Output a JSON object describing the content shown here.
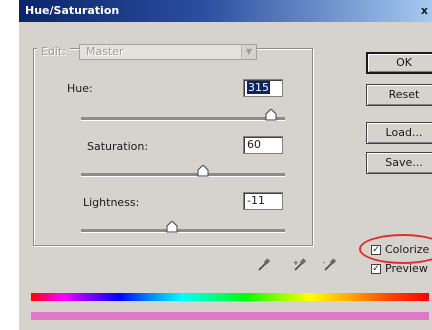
{
  "window": {
    "title": "Hue/Saturation",
    "close_glyph": "x"
  },
  "edit": {
    "label": "Edit:",
    "value": "Master",
    "arrow_glyph": "▼"
  },
  "hue": {
    "label": "Hue:",
    "value": "315",
    "slider_fraction": 0.93
  },
  "saturation": {
    "label": "Saturation:",
    "value": "60",
    "slider_fraction": 0.6
  },
  "lightness": {
    "label": "Lightness:",
    "value": "-11",
    "slider_fraction": 0.445
  },
  "buttons": {
    "ok": "OK",
    "reset": "Reset",
    "load": "Load...",
    "save": "Save..."
  },
  "checkboxes": {
    "colorize": {
      "label": "Colorize",
      "checked": true
    },
    "preview": {
      "label": "Preview",
      "checked": true
    },
    "check_glyph": "✓"
  },
  "icons": {
    "eyedroppers": [
      "eyedropper-icon",
      "eyedropper-plus-icon",
      "eyedropper-minus-icon"
    ]
  },
  "colors": {
    "title_bar": "#0a246a",
    "dialog_bg": "#d6d3ce",
    "highlight_ring": "#e02d2d",
    "output_bar": "#e07ac8"
  }
}
